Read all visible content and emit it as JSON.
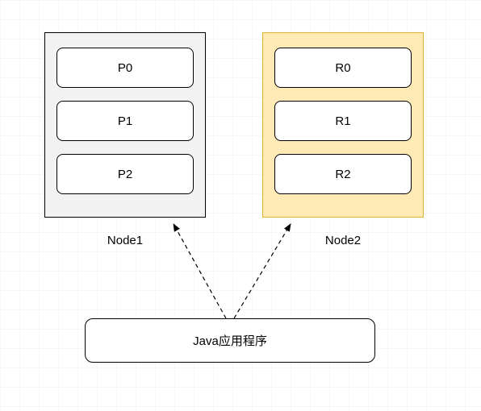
{
  "diagram": {
    "node1": {
      "label": "Node1",
      "slots": [
        "P0",
        "P1",
        "P2"
      ]
    },
    "node2": {
      "label": "Node2",
      "slots": [
        "R0",
        "R1",
        "R2"
      ]
    },
    "app_label": "Java应用程序"
  }
}
